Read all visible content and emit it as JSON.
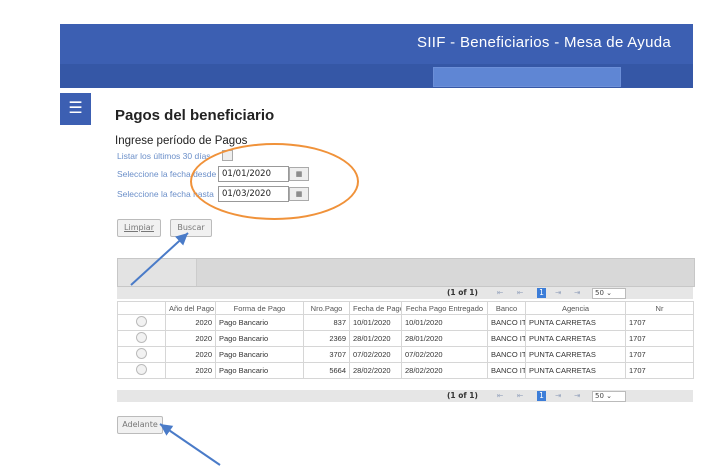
{
  "header": {
    "title_prefix": "SIIF - ",
    "title_bold": "Beneficiarios",
    "title_suffix": " - Mesa de Ayuda"
  },
  "page": {
    "menu_icon": "hamburger-icon",
    "title": "Pagos del beneficiario",
    "section_title": "Ingrese período de Pagos"
  },
  "form": {
    "last30_label": "Listar los últimos 30 días",
    "from_label": "Seleccione la fecha desde",
    "from_value": "01/01/2020",
    "to_label": "Seleccione la fecha hasta",
    "to_value": "01/03/2020",
    "calendar_icon": "calendar-icon",
    "clear_button": "Limpiar",
    "search_button": "Buscar"
  },
  "pager": {
    "info": "(1 of 1)",
    "first": "⇤",
    "prev": "⇤",
    "current_page": "1",
    "next": "⇥",
    "last": "⇥",
    "page_size": "50"
  },
  "table": {
    "headers": [
      "",
      "Año del Pago",
      "Forma de Pago",
      "Nro.Pago",
      "Fecha de Pago",
      "Fecha Pago Entregado",
      "Banco",
      "Agencia",
      "Nr"
    ],
    "rows": [
      {
        "year": "2020",
        "method": "Pago Bancario",
        "number": "837",
        "date": "10/01/2020",
        "delivered": "10/01/2020",
        "bank": "BANCO IT",
        "agency": "PUNTA CARRETAS",
        "nr": "1707"
      },
      {
        "year": "2020",
        "method": "Pago Bancario",
        "number": "2369",
        "date": "28/01/2020",
        "delivered": "28/01/2020",
        "bank": "BANCO IT",
        "agency": "PUNTA CARRETAS",
        "nr": "1707"
      },
      {
        "year": "2020",
        "method": "Pago Bancario",
        "number": "3707",
        "date": "07/02/2020",
        "delivered": "07/02/2020",
        "bank": "BANCO IT",
        "agency": "PUNTA CARRETAS",
        "nr": "1707"
      },
      {
        "year": "2020",
        "method": "Pago Bancario",
        "number": "5664",
        "date": "28/02/2020",
        "delivered": "28/02/2020",
        "bank": "BANCO IT",
        "agency": "PUNTA CARRETAS",
        "nr": "1707"
      }
    ]
  },
  "footer": {
    "next_button": "Adelante"
  },
  "colors": {
    "header_bg": "#3c5fb2",
    "highlight_ellipse": "#f0923a",
    "annotation_arrow": "#4a7bc8"
  }
}
